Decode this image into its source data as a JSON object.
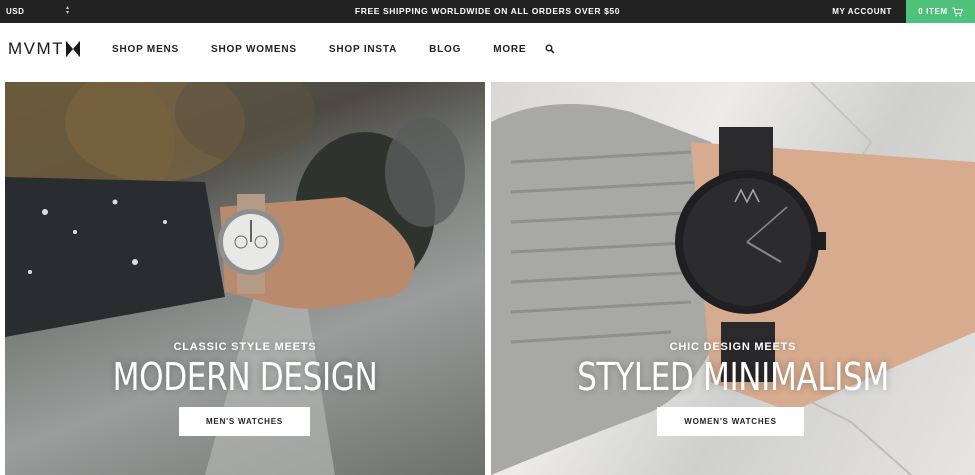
{
  "topbar": {
    "currency": "USD",
    "promo": "FREE SHIPPING WORLDWIDE ON ALL ORDERS OVER $50",
    "account": "MY ACCOUNT",
    "cart_label": "0 ITEM",
    "cart_color": "#4ec27a"
  },
  "nav": {
    "logo": "MVMT",
    "links": [
      "SHOP MENS",
      "SHOP WOMENS",
      "SHOP INSTA",
      "BLOG",
      "MORE"
    ],
    "search_icon": "search-icon"
  },
  "hero": {
    "left": {
      "kicker": "CLASSIC STYLE MEETS",
      "headline": "MODERN DESIGN",
      "cta": "MEN'S WATCHES"
    },
    "right": {
      "kicker": "CHIC DESIGN MEETS",
      "headline": "STYLED MINIMALISM",
      "cta": "WOMEN'S WATCHES"
    }
  }
}
